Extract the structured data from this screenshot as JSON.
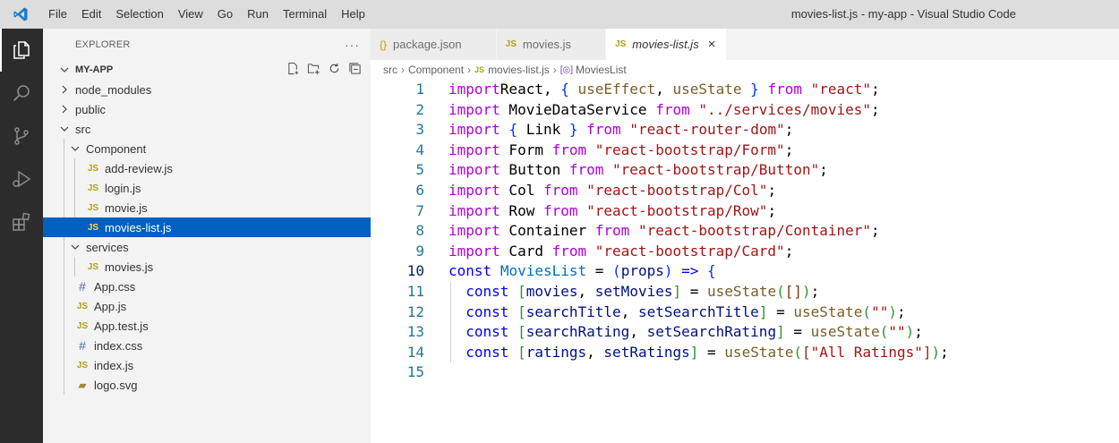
{
  "window": {
    "title": "movies-list.js - my-app - Visual Studio Code",
    "menu": [
      "File",
      "Edit",
      "Selection",
      "View",
      "Go",
      "Run",
      "Terminal",
      "Help"
    ]
  },
  "activity_bar": {
    "items": [
      "explorer-icon",
      "search-icon",
      "source-control-icon",
      "run-debug-icon",
      "extensions-icon"
    ],
    "active": "explorer-icon"
  },
  "explorer": {
    "header": "EXPLORER",
    "more": "···",
    "project": "MY-APP",
    "tree": [
      {
        "label": "node_modules",
        "type": "folder",
        "expanded": false,
        "depth": 0
      },
      {
        "label": "public",
        "type": "folder",
        "expanded": false,
        "depth": 0
      },
      {
        "label": "src",
        "type": "folder",
        "expanded": true,
        "depth": 0
      },
      {
        "label": "Component",
        "type": "folder",
        "expanded": true,
        "depth": 1
      },
      {
        "label": "add-review.js",
        "type": "js",
        "depth": 2
      },
      {
        "label": "login.js",
        "type": "js",
        "depth": 2
      },
      {
        "label": "movie.js",
        "type": "js",
        "depth": 2
      },
      {
        "label": "movies-list.js",
        "type": "js",
        "depth": 2,
        "selected": true
      },
      {
        "label": "services",
        "type": "folder",
        "expanded": true,
        "depth": 1
      },
      {
        "label": "movies.js",
        "type": "js",
        "depth": 2
      },
      {
        "label": "App.css",
        "type": "css",
        "depth": 1
      },
      {
        "label": "App.js",
        "type": "js",
        "depth": 1
      },
      {
        "label": "App.test.js",
        "type": "js",
        "depth": 1
      },
      {
        "label": "index.css",
        "type": "css",
        "depth": 1
      },
      {
        "label": "index.js",
        "type": "js",
        "depth": 1
      },
      {
        "label": "logo.svg",
        "type": "svg",
        "depth": 1
      }
    ],
    "icon_labels": {
      "js": "JS",
      "css": "#"
    }
  },
  "tabs": [
    {
      "label": "package.json",
      "icon": "{}",
      "active": false
    },
    {
      "label": "movies.js",
      "icon": "JS",
      "active": false
    },
    {
      "label": "movies-list.js",
      "icon": "JS",
      "active": true,
      "close": "×"
    }
  ],
  "breadcrumbs": {
    "items": [
      "src",
      "Component",
      "movies-list.js",
      "MoviesList"
    ],
    "file_icon": "JS",
    "symbol_icon": "[◎]"
  },
  "code": {
    "current_line": 10,
    "lines": [
      {
        "n": "1",
        "tokens": [
          [
            "kw2",
            "import"
          ],
          [
            "",
            "React, "
          ],
          [
            "b1",
            "{"
          ],
          [
            "",
            ""
          ],
          [
            "fn",
            " useEffect"
          ],
          [
            "",
            ", "
          ],
          [
            "fn",
            "useState"
          ],
          [
            "",
            " "
          ],
          [
            "b1",
            "}"
          ],
          [
            "kw2",
            " from"
          ],
          [
            "",
            " "
          ],
          [
            "str",
            "\"react\""
          ],
          [
            "",
            ";"
          ]
        ]
      },
      {
        "n": "2",
        "tokens": [
          [
            "kw2",
            "import"
          ],
          [
            "",
            " MovieDataService "
          ],
          [
            "kw2",
            "from"
          ],
          [
            "",
            " "
          ],
          [
            "str",
            "\"../services/movies\""
          ],
          [
            "",
            ";"
          ]
        ]
      },
      {
        "n": "3",
        "tokens": [
          [
            "kw2",
            "import"
          ],
          [
            "",
            " "
          ],
          [
            "b1",
            "{"
          ],
          [
            "",
            " Link "
          ],
          [
            "b1",
            "}"
          ],
          [
            "",
            " "
          ],
          [
            "kw2",
            "from"
          ],
          [
            "",
            " "
          ],
          [
            "str",
            "\"react-router-dom\""
          ],
          [
            "",
            ";"
          ]
        ]
      },
      {
        "n": "4",
        "tokens": [
          [
            "kw2",
            "import"
          ],
          [
            "",
            " Form "
          ],
          [
            "kw2",
            "from"
          ],
          [
            "",
            " "
          ],
          [
            "str",
            "\"react-bootstrap/Form\""
          ],
          [
            "",
            ";"
          ]
        ]
      },
      {
        "n": "5",
        "tokens": [
          [
            "kw2",
            "import"
          ],
          [
            "",
            " Button "
          ],
          [
            "kw2",
            "from"
          ],
          [
            "",
            " "
          ],
          [
            "str",
            "\"react-bootstrap/Button\""
          ],
          [
            "",
            ";"
          ]
        ]
      },
      {
        "n": "6",
        "tokens": [
          [
            "kw2",
            "import"
          ],
          [
            "",
            " Col "
          ],
          [
            "kw2",
            "from"
          ],
          [
            "",
            " "
          ],
          [
            "str",
            "\"react-bootstrap/Col\""
          ],
          [
            "",
            ";"
          ]
        ]
      },
      {
        "n": "7",
        "tokens": [
          [
            "kw2",
            "import"
          ],
          [
            "",
            " Row "
          ],
          [
            "kw2",
            "from"
          ],
          [
            "",
            " "
          ],
          [
            "str",
            "\"react-bootstrap/Row\""
          ],
          [
            "",
            ";"
          ]
        ]
      },
      {
        "n": "8",
        "tokens": [
          [
            "kw2",
            "import"
          ],
          [
            "",
            " Container "
          ],
          [
            "kw2",
            "from"
          ],
          [
            "",
            " "
          ],
          [
            "str",
            "\"react-bootstrap/Container\""
          ],
          [
            "",
            ";"
          ]
        ]
      },
      {
        "n": "9",
        "tokens": [
          [
            "kw2",
            "import"
          ],
          [
            "",
            " Card "
          ],
          [
            "kw2",
            "from"
          ],
          [
            "",
            " "
          ],
          [
            "str",
            "\"react-bootstrap/Card\""
          ],
          [
            "",
            ";"
          ]
        ]
      },
      {
        "n": "10",
        "tokens": [
          [
            "kw",
            "const"
          ],
          [
            "",
            " "
          ],
          [
            "cls",
            "MoviesList"
          ],
          [
            "",
            " = "
          ],
          [
            "b1",
            "("
          ],
          [
            "var",
            "props"
          ],
          [
            "b1",
            ")"
          ],
          [
            "",
            " "
          ],
          [
            "kw",
            "=>"
          ],
          [
            "",
            " "
          ],
          [
            "b1",
            "{"
          ]
        ]
      },
      {
        "n": "11",
        "tokens": [
          [
            "",
            "  "
          ],
          [
            "kw",
            "const"
          ],
          [
            "",
            " "
          ],
          [
            "b2",
            "["
          ],
          [
            "var",
            "movies"
          ],
          [
            "",
            ", "
          ],
          [
            "var",
            "setMovies"
          ],
          [
            "b2",
            "]"
          ],
          [
            "",
            " = "
          ],
          [
            "fn",
            "useState"
          ],
          [
            "b2",
            "("
          ],
          [
            "b3",
            "[]"
          ],
          [
            "b2",
            ")"
          ],
          [
            "",
            ";"
          ]
        ]
      },
      {
        "n": "12",
        "tokens": [
          [
            "",
            "  "
          ],
          [
            "kw",
            "const"
          ],
          [
            "",
            " "
          ],
          [
            "b2",
            "["
          ],
          [
            "var",
            "searchTitle"
          ],
          [
            "",
            ", "
          ],
          [
            "var",
            "setSearchTitle"
          ],
          [
            "b2",
            "]"
          ],
          [
            "",
            " = "
          ],
          [
            "fn",
            "useState"
          ],
          [
            "b2",
            "("
          ],
          [
            "str",
            "\"\""
          ],
          [
            "b2",
            ")"
          ],
          [
            "",
            ";"
          ]
        ]
      },
      {
        "n": "13",
        "tokens": [
          [
            "",
            "  "
          ],
          [
            "kw",
            "const"
          ],
          [
            "",
            " "
          ],
          [
            "b2",
            "["
          ],
          [
            "var",
            "searchRating"
          ],
          [
            "",
            ", "
          ],
          [
            "var",
            "setSearchRating"
          ],
          [
            "b2",
            "]"
          ],
          [
            "",
            " = "
          ],
          [
            "fn",
            "useState"
          ],
          [
            "b2",
            "("
          ],
          [
            "str",
            "\"\""
          ],
          [
            "b2",
            ")"
          ],
          [
            "",
            ";"
          ]
        ]
      },
      {
        "n": "14",
        "tokens": [
          [
            "",
            "  "
          ],
          [
            "kw",
            "const"
          ],
          [
            "",
            " "
          ],
          [
            "b2",
            "["
          ],
          [
            "var",
            "ratings"
          ],
          [
            "",
            ", "
          ],
          [
            "var",
            "setRatings"
          ],
          [
            "b2",
            "]"
          ],
          [
            "",
            " = "
          ],
          [
            "fn",
            "useState"
          ],
          [
            "b2",
            "("
          ],
          [
            "b3",
            "["
          ],
          [
            "str",
            "\"All Ratings\""
          ],
          [
            "b3",
            "]"
          ],
          [
            "b2",
            ")"
          ],
          [
            "",
            ";"
          ]
        ]
      },
      {
        "n": "15",
        "tokens": []
      }
    ]
  },
  "colors": {
    "activity_bar": "#2c2c2c",
    "title_bar": "#dddddd",
    "selection": "#0060c0",
    "keyword": "#0000ff",
    "import_keyword": "#af00db",
    "string": "#a31515"
  }
}
